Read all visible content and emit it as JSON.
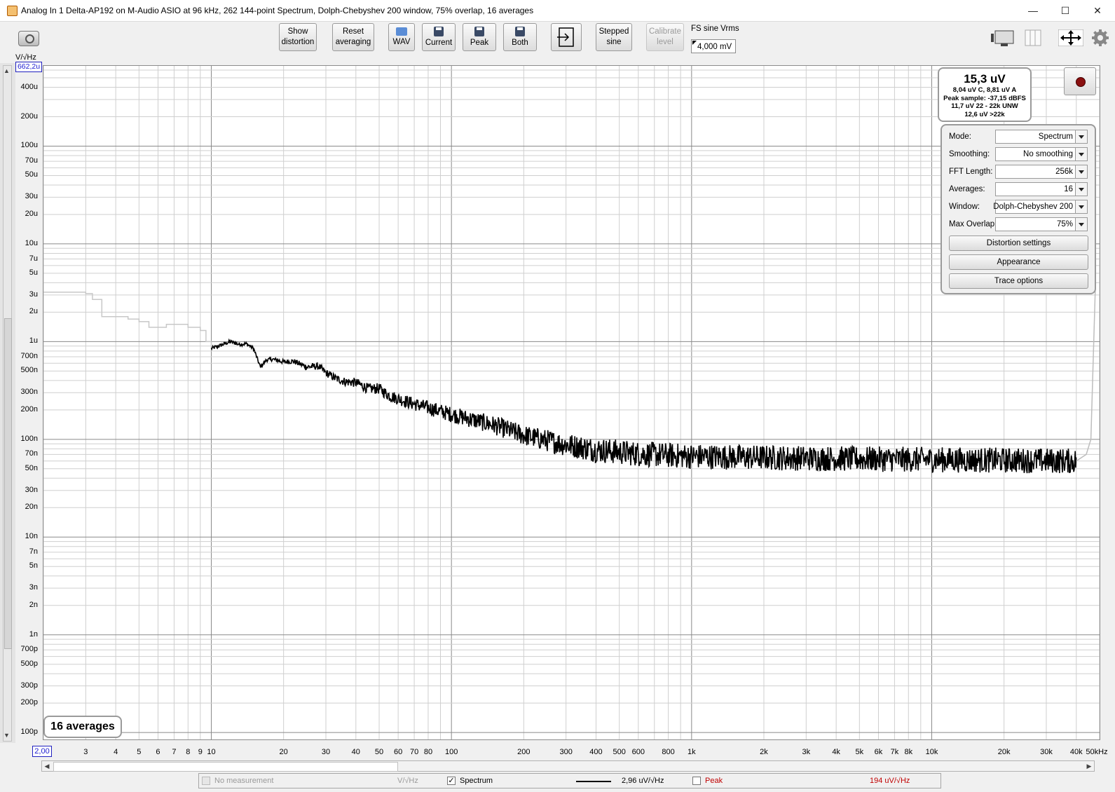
{
  "window": {
    "title": "Analog In 1 Delta-AP192 on M-Audio ASIO at 96 kHz, 262 144-point Spectrum, Dolph-Chebyshev 200 window, 75% overlap, 16 averages",
    "minimize": "—",
    "maximize": "☐",
    "close": "✕"
  },
  "toolbar": {
    "show_distortion": [
      "Show",
      "distortion"
    ],
    "reset_averaging": [
      "Reset",
      "averaging"
    ],
    "wav": "WAV",
    "current": "Current",
    "peak": "Peak",
    "both": "Both",
    "stepped_sine": [
      "Stepped",
      "sine"
    ],
    "calibrate_level": [
      "Calibrate",
      "level"
    ],
    "fs_label": "FS sine Vrms",
    "fs_value": "4,000 mV"
  },
  "readout": {
    "main": "15,3 uV",
    "line1": "8,04 uV C, 8,81 uV A",
    "line2": "Peak sample: -37,15 dBFS",
    "line3": "11,7 uV 22 - 22k UNW",
    "line4": "12,6 uV >22k"
  },
  "controls": {
    "mode_label": "Mode:",
    "mode_value": "Spectrum",
    "smoothing_label": "Smoothing:",
    "smoothing_value": "No  smoothing",
    "fft_label": "FFT Length:",
    "fft_value": "256k",
    "averages_label": "Averages:",
    "averages_value": "16",
    "window_label": "Window:",
    "window_value": "Dolph-Chebyshev 200",
    "overlap_label": "Max Overlap:",
    "overlap_value": "75%",
    "distortion_settings": "Distortion settings",
    "appearance": "Appearance",
    "trace_options": "Trace options"
  },
  "averages_badge": "16 averages",
  "legend": {
    "no_measurement": "No measurement",
    "unit1": "V/√Hz",
    "spectrum_label": "Spectrum",
    "spectrum_value": "2,96 uV/√Hz",
    "peak_label": "Peak",
    "peak_value": "194 uV/√Hz"
  },
  "chart_data": {
    "type": "line",
    "title": "",
    "ylabel": "V/√Hz",
    "xlabel": "",
    "x_scale": "log",
    "y_scale": "log",
    "xlim": [
      2,
      50000
    ],
    "ylim": [
      8.5e-11,
      0.0006622
    ],
    "y_max_display": "662,2u",
    "x_min_display": "2,00",
    "y_tick_labels": [
      {
        "v": 0.0004,
        "t": "400u"
      },
      {
        "v": 0.0002,
        "t": "200u"
      },
      {
        "v": 0.0001,
        "t": "100u"
      },
      {
        "v": 7e-05,
        "t": "70u"
      },
      {
        "v": 5e-05,
        "t": "50u"
      },
      {
        "v": 3e-05,
        "t": "30u"
      },
      {
        "v": 2e-05,
        "t": "20u"
      },
      {
        "v": 1e-05,
        "t": "10u"
      },
      {
        "v": 7e-06,
        "t": "7u"
      },
      {
        "v": 5e-06,
        "t": "5u"
      },
      {
        "v": 3e-06,
        "t": "3u"
      },
      {
        "v": 2e-06,
        "t": "2u"
      },
      {
        "v": 1e-06,
        "t": "1u"
      },
      {
        "v": 7e-07,
        "t": "700n"
      },
      {
        "v": 5e-07,
        "t": "500n"
      },
      {
        "v": 3e-07,
        "t": "300n"
      },
      {
        "v": 2e-07,
        "t": "200n"
      },
      {
        "v": 1e-07,
        "t": "100n"
      },
      {
        "v": 7e-08,
        "t": "70n"
      },
      {
        "v": 5e-08,
        "t": "50n"
      },
      {
        "v": 3e-08,
        "t": "30n"
      },
      {
        "v": 2e-08,
        "t": "20n"
      },
      {
        "v": 1e-08,
        "t": "10n"
      },
      {
        "v": 7e-09,
        "t": "7n"
      },
      {
        "v": 5e-09,
        "t": "5n"
      },
      {
        "v": 3e-09,
        "t": "3n"
      },
      {
        "v": 2e-09,
        "t": "2n"
      },
      {
        "v": 1e-09,
        "t": "1n"
      },
      {
        "v": 7e-10,
        "t": "700p"
      },
      {
        "v": 5e-10,
        "t": "500p"
      },
      {
        "v": 3e-10,
        "t": "300p"
      },
      {
        "v": 2e-10,
        "t": "200p"
      },
      {
        "v": 1e-10,
        "t": "100p"
      }
    ],
    "x_tick_labels": [
      {
        "v": 3,
        "t": "3"
      },
      {
        "v": 4,
        "t": "4"
      },
      {
        "v": 5,
        "t": "5"
      },
      {
        "v": 6,
        "t": "6"
      },
      {
        "v": 7,
        "t": "7"
      },
      {
        "v": 8,
        "t": "8"
      },
      {
        "v": 9,
        "t": "9"
      },
      {
        "v": 10,
        "t": "10"
      },
      {
        "v": 20,
        "t": "20"
      },
      {
        "v": 30,
        "t": "30"
      },
      {
        "v": 40,
        "t": "40"
      },
      {
        "v": 50,
        "t": "50"
      },
      {
        "v": 60,
        "t": "60"
      },
      {
        "v": 70,
        "t": "70"
      },
      {
        "v": 80,
        "t": "80"
      },
      {
        "v": 100,
        "t": "100"
      },
      {
        "v": 200,
        "t": "200"
      },
      {
        "v": 300,
        "t": "300"
      },
      {
        "v": 400,
        "t": "400"
      },
      {
        "v": 500,
        "t": "500"
      },
      {
        "v": 600,
        "t": "600"
      },
      {
        "v": 800,
        "t": "800"
      },
      {
        "v": 1000,
        "t": "1k"
      },
      {
        "v": 2000,
        "t": "2k"
      },
      {
        "v": 3000,
        "t": "3k"
      },
      {
        "v": 4000,
        "t": "4k"
      },
      {
        "v": 5000,
        "t": "5k"
      },
      {
        "v": 6000,
        "t": "6k"
      },
      {
        "v": 7000,
        "t": "7k"
      },
      {
        "v": 8000,
        "t": "8k"
      },
      {
        "v": 10000,
        "t": "10k"
      },
      {
        "v": 20000,
        "t": "20k"
      },
      {
        "v": 30000,
        "t": "30k"
      },
      {
        "v": 40000,
        "t": "40k"
      },
      {
        "v": 50000,
        "t": "50kHz"
      }
    ],
    "series": [
      {
        "color": "#c8c8c8",
        "x": [
          2,
          2.5,
          3,
          3.2,
          3.5,
          4,
          4.5,
          5,
          5.5,
          6,
          6.5,
          7,
          8,
          9,
          9.5,
          10
        ],
        "y": [
          3.2e-06,
          3.2e-06,
          3.1e-06,
          2.7e-06,
          1.8e-06,
          1.8e-06,
          1.7e-06,
          1.6e-06,
          1.4e-06,
          1.4e-06,
          1.5e-06,
          1.5e-06,
          1.4e-06,
          1.3e-06,
          1e-06,
          8.5e-07
        ]
      },
      {
        "color": "#000000",
        "x": [
          10,
          11,
          12,
          13,
          14,
          15,
          16,
          17,
          18,
          20,
          22,
          25,
          28,
          30,
          33,
          36,
          40,
          45,
          50,
          55,
          60,
          70,
          80,
          100,
          150,
          200,
          300,
          400,
          600,
          1000,
          2000,
          5000,
          10000,
          20000,
          40000
        ],
        "y": [
          8.5e-07,
          9.2e-07,
          1e-06,
          9.4e-07,
          9.5e-07,
          8.5e-07,
          5.5e-07,
          6.5e-07,
          6.6e-07,
          6.2e-07,
          6.3e-07,
          5.5e-07,
          5.6e-07,
          4.8e-07,
          4.2e-07,
          3.9e-07,
          3.8e-07,
          3.3e-07,
          3.3e-07,
          2.8e-07,
          2.6e-07,
          2.3e-07,
          2.1e-07,
          1.8e-07,
          1.4e-07,
          1.1e-07,
          8.8e-08,
          7.8e-08,
          7.1e-08,
          6.7e-08,
          6.5e-08,
          6.3e-08,
          6.2e-08,
          6.1e-08,
          6e-08
        ],
        "noise_spread_decades": 0.13
      },
      {
        "color": "#bdbdbd",
        "x": [
          40000,
          42000,
          44000,
          46000,
          48000
        ],
        "y": [
          6e-08,
          6.5e-08,
          7e-08,
          1e-07,
          3.5e-06
        ]
      }
    ],
    "grid": true
  }
}
